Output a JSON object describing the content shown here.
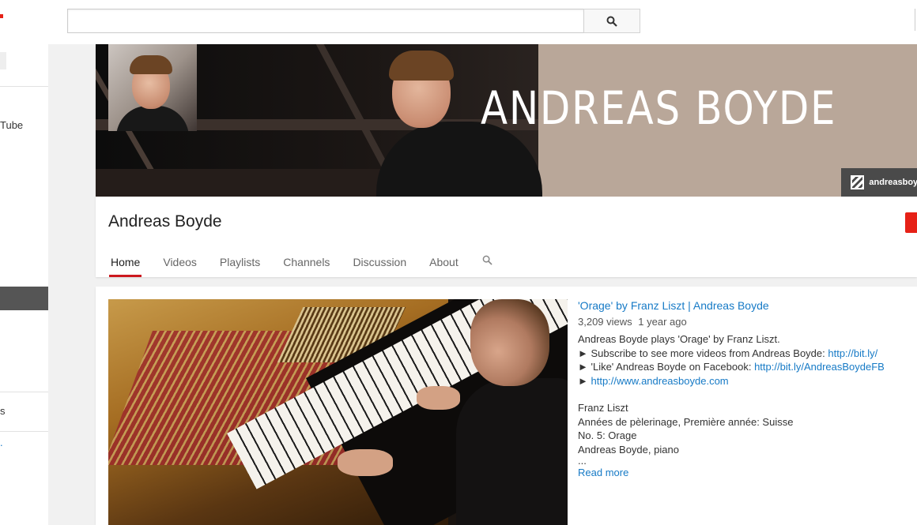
{
  "search": {
    "placeholder": "",
    "value": ""
  },
  "guide": {
    "item_fragment_1": "Tube",
    "item_fragment_2": "s"
  },
  "channel": {
    "banner_title": "ANDREAS BOYDE",
    "banner_link": "andreasboyde",
    "name": "Andreas Boyde",
    "tabs": [
      "Home",
      "Videos",
      "Playlists",
      "Channels",
      "Discussion",
      "About"
    ],
    "active_tab": "Home"
  },
  "featured_video": {
    "title": "'Orage' by Franz Liszt | Andreas Boyde",
    "views": "3,209 views",
    "age": "1 year ago",
    "description": {
      "line1": "Andreas Boyde plays 'Orage' by Franz Liszt.",
      "line2_text": "► Subscribe to see more videos from Andreas Boyde: ",
      "line2_link": "http://bit.ly/",
      "line3_text": "► 'Like' Andreas Boyde on Facebook: ",
      "line3_link": "http://bit.ly/AndreasBoydeFB",
      "line4_prefix": "► ",
      "line4_link": "http://www.andreasboyde.com",
      "line5": "Franz Liszt",
      "line6": "Années de pèlerinage, Première année: Suisse",
      "line7": "No. 5: Orage",
      "line8": "Andreas Boyde, piano",
      "line9": "..."
    },
    "read_more": "Read more"
  },
  "colors": {
    "accent_red": "#cc181e",
    "link_blue": "#167ac6",
    "brand_red": "#e62117"
  }
}
